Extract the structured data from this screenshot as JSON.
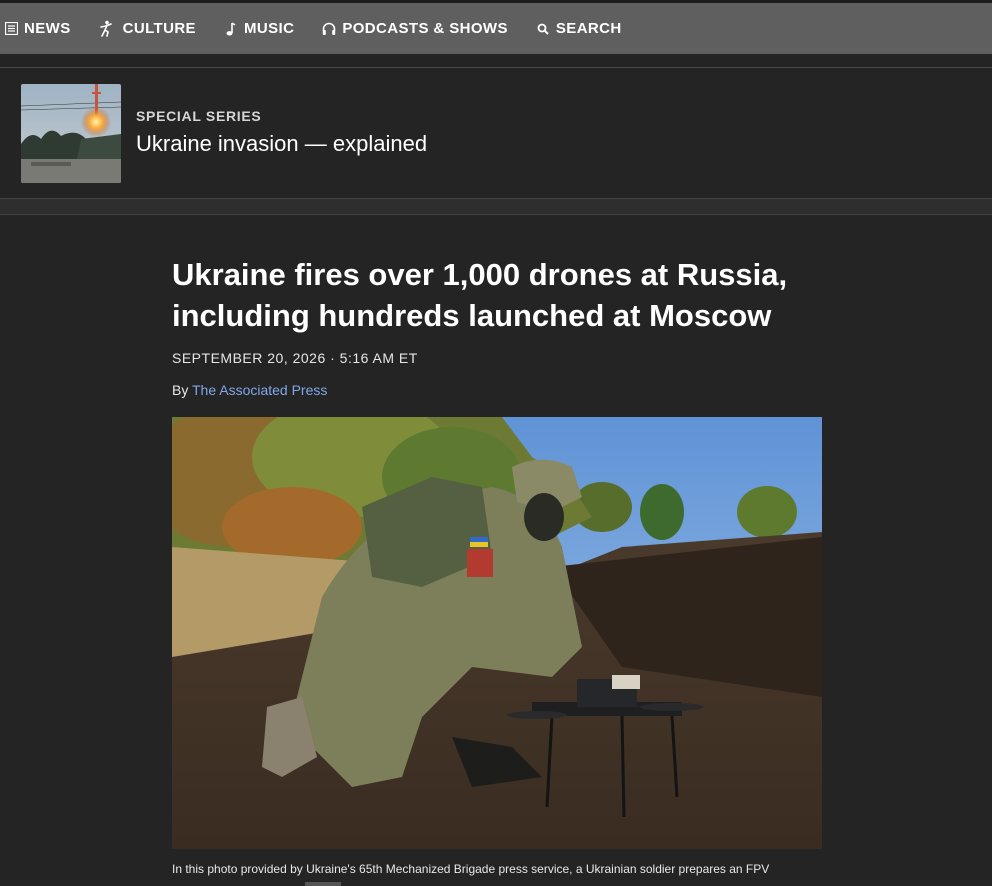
{
  "nav": {
    "items": [
      {
        "label": "NEWS",
        "icon": "news-icon"
      },
      {
        "label": "CULTURE",
        "icon": "culture-icon"
      },
      {
        "label": "MUSIC",
        "icon": "music-note-icon"
      },
      {
        "label": "PODCASTS & SHOWS",
        "icon": "headphones-icon"
      },
      {
        "label": "SEARCH",
        "icon": "search-icon"
      }
    ]
  },
  "series": {
    "kicker": "SPECIAL SERIES",
    "title": "Ukraine invasion — explained"
  },
  "article": {
    "headline": "Ukraine fires over 1,000 drones at Russia, including hundreds launched at Moscow",
    "dateline": "SEPTEMBER 20, 2026 · 5:16 AM ET",
    "by_prefix": "By",
    "author": "The Associated Press",
    "caption": "In this photo provided by Ukraine's 65th Mechanized Brigade press service, a Ukrainian soldier prepares an FPV"
  },
  "colors": {
    "background": "#242424",
    "topbar": "#5f5f5f",
    "link": "#7fa8e8"
  }
}
